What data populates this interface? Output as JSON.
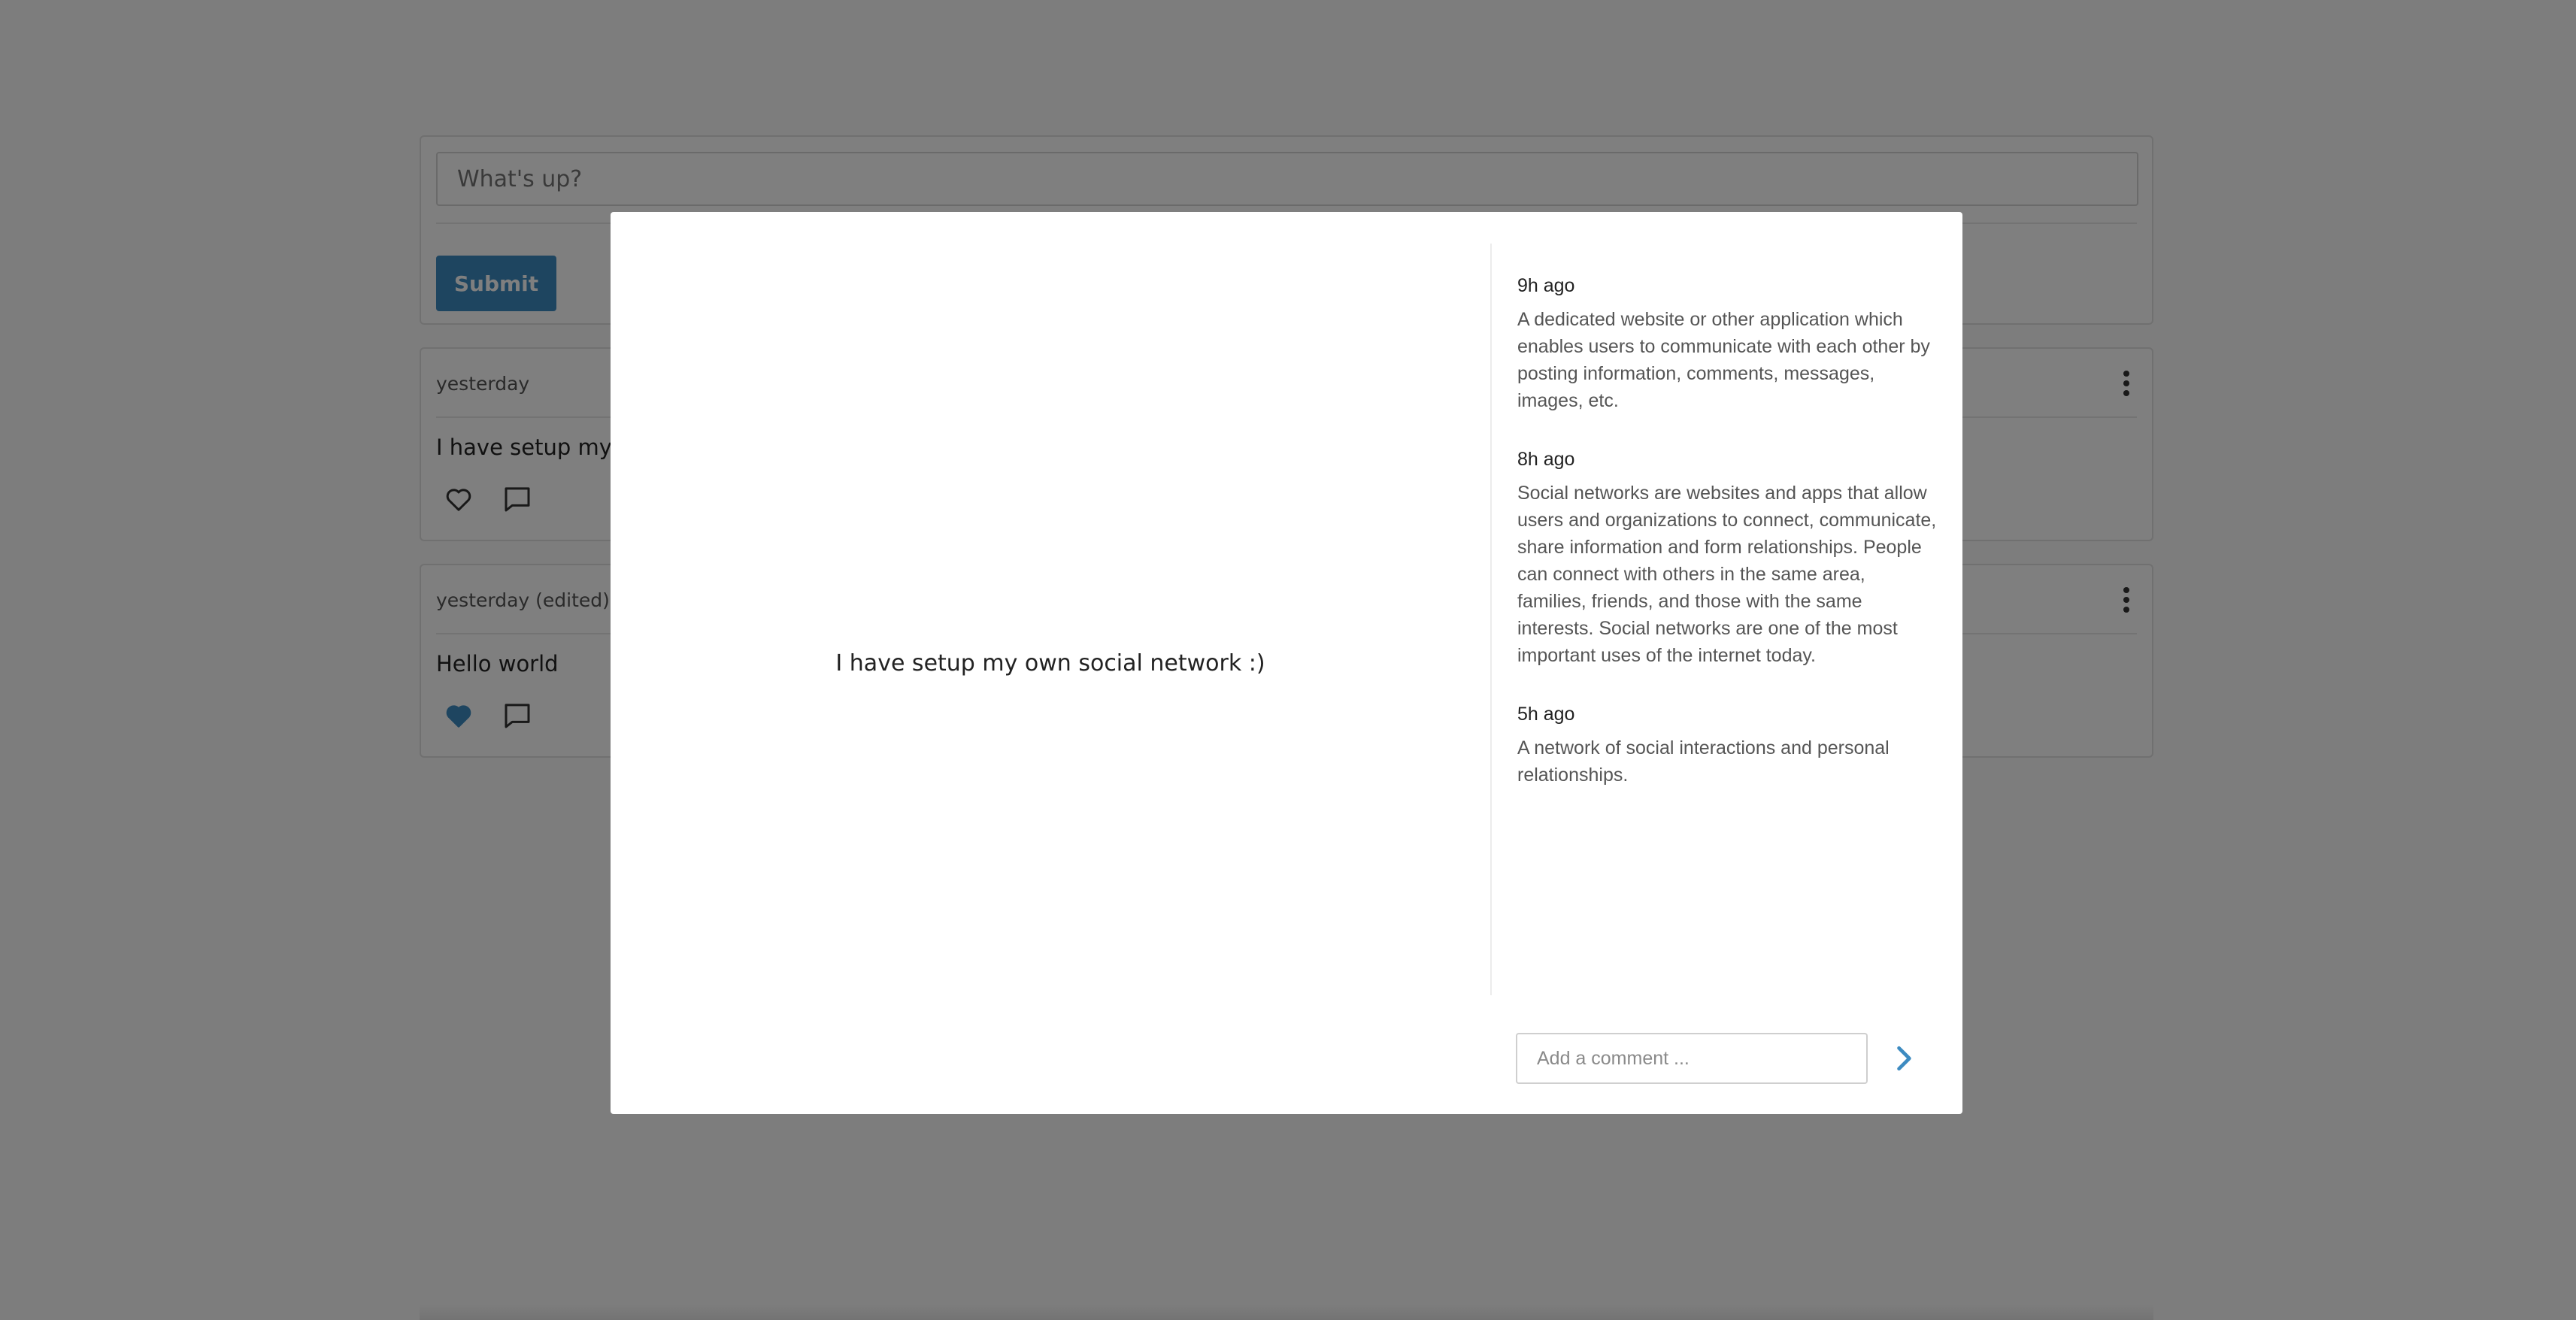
{
  "composer": {
    "placeholder": "What's up?",
    "submit_label": "Submit"
  },
  "posts": [
    {
      "time": "yesterday",
      "text": "I have setup my own social network :)",
      "liked": false
    },
    {
      "time": "yesterday (edited)",
      "text": "Hello world",
      "liked": true
    }
  ],
  "modal": {
    "post_text": "I have setup my own social network :)",
    "comments": [
      {
        "time": "9h ago",
        "text": "A dedicated website or other application which enables users to communicate with each other by posting information, comments, messages, images, etc."
      },
      {
        "time": "8h ago",
        "text": "Social networks are websites and apps that allow users and organizations to connect, communicate, share information and form relationships. People can connect with others in the same area, families, friends, and those with the same interests. Social networks are one of the most important uses of the internet today."
      },
      {
        "time": "5h ago",
        "text": "A network of social interactions and personal relationships."
      }
    ],
    "comment_placeholder": "Add a comment ..."
  },
  "colors": {
    "accent": "#3d8bc1",
    "overlay": "rgba(0,0,0,0.5)"
  },
  "icons": {
    "like": "heart-icon",
    "comment": "comment-icon",
    "menu": "more-vertical-icon",
    "send": "chevron-right-icon"
  }
}
